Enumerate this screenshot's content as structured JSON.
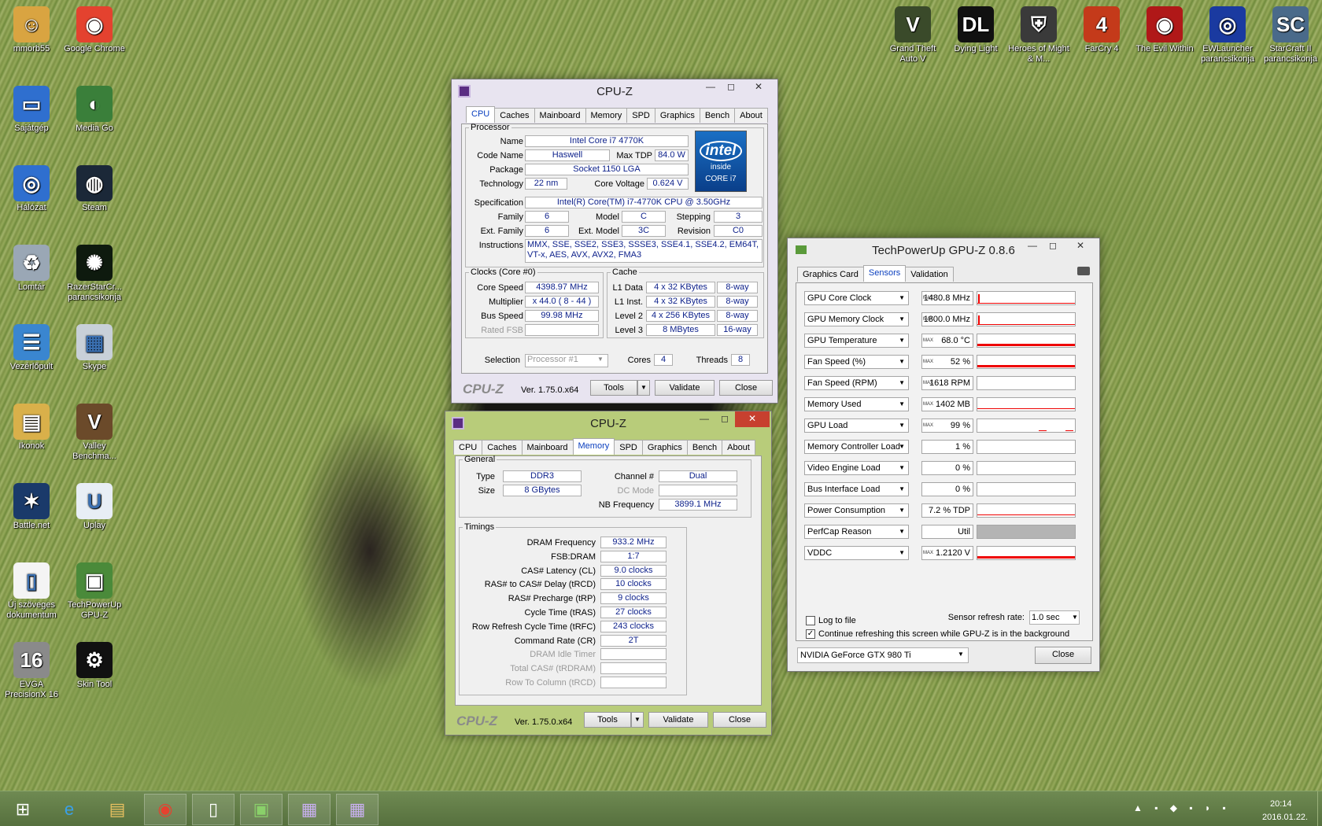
{
  "desktop_icons": [
    {
      "label": "mmorb55",
      "icon": "user-folder-icon",
      "color": "#d9a441"
    },
    {
      "label": "Google Chrome",
      "icon": "chrome-icon",
      "color": "#e4422f"
    },
    {
      "label": "Sajátgép",
      "icon": "computer-icon",
      "color": "#2f6fcf"
    },
    {
      "label": "Media Go",
      "icon": "media-go-icon",
      "color": "#3a7f3a"
    },
    {
      "label": "Hálózat",
      "icon": "network-icon",
      "color": "#2f6fcf"
    },
    {
      "label": "Steam",
      "icon": "steam-icon",
      "color": "#1b2838"
    },
    {
      "label": "Lomtár",
      "icon": "recycle-bin-icon",
      "color": "#9aa7b5"
    },
    {
      "label": "RazerStarCr... parancsikonja",
      "icon": "razer-icon",
      "color": "#0e1a0e"
    },
    {
      "label": "Vezérlőpult",
      "icon": "control-panel-icon",
      "color": "#3a86d0"
    },
    {
      "label": "Skype",
      "icon": "skype-icon",
      "color": "#c8d0d8"
    },
    {
      "label": "Ikonok",
      "icon": "folder-icon",
      "color": "#d9b04a"
    },
    {
      "label": "Valley Benchma...",
      "icon": "valley-icon",
      "color": "#6b4a2a"
    },
    {
      "label": "Battle.net",
      "icon": "battlenet-icon",
      "color": "#1a3a6a"
    },
    {
      "label": "Uplay",
      "icon": "uplay-icon",
      "color": "#e8eef5"
    },
    {
      "label": "Új szöveges dokumentum",
      "icon": "text-document-icon",
      "color": "#f4f4f4"
    },
    {
      "label": "TechPowerUp GPU-Z",
      "icon": "gpuz-icon",
      "color": "#4a8a3a"
    },
    {
      "label": "EVGA PrecisionX 16",
      "icon": "evga-icon",
      "color": "#8a8a8a"
    },
    {
      "label": "Skin Tool",
      "icon": "skin-tool-icon",
      "color": "#111111"
    }
  ],
  "top_icons": [
    {
      "label": "Grand Theft Auto V",
      "icon": "gta-icon"
    },
    {
      "label": "Dying Light",
      "icon": "dying-light-icon"
    },
    {
      "label": "Heroes of Might & M...",
      "icon": "heroes-icon"
    },
    {
      "label": "FarCry 4",
      "icon": "farcry-icon"
    },
    {
      "label": "The Evil Within",
      "icon": "evil-within-icon"
    },
    {
      "label": "EWLauncher parancsikonja",
      "icon": "ewlauncher-icon"
    },
    {
      "label": "StarCraft II parancsikonja",
      "icon": "starcraft-icon"
    }
  ],
  "cpuz1": {
    "title": "CPU-Z",
    "tabs": [
      "CPU",
      "Caches",
      "Mainboard",
      "Memory",
      "SPD",
      "Graphics",
      "Bench",
      "About"
    ],
    "processor_legend": "Processor",
    "name_lbl": "Name",
    "name": "Intel Core i7 4770K",
    "codename_lbl": "Code Name",
    "codename": "Haswell",
    "maxtdp_lbl": "Max TDP",
    "maxtdp": "84.0 W",
    "package_lbl": "Package",
    "package": "Socket 1150 LGA",
    "tech_lbl": "Technology",
    "tech": "22 nm",
    "cv_lbl": "Core Voltage",
    "cv": "0.624 V",
    "spec_lbl": "Specification",
    "spec": "Intel(R) Core(TM) i7-4770K CPU @ 3.50GHz",
    "family_lbl": "Family",
    "family": "6",
    "model_lbl": "Model",
    "model": "C",
    "stepping_lbl": "Stepping",
    "stepping": "3",
    "extfamily_lbl": "Ext. Family",
    "extfamily": "6",
    "extmodel_lbl": "Ext. Model",
    "extmodel": "3C",
    "revision_lbl": "Revision",
    "revision": "C0",
    "instr_lbl": "Instructions",
    "instr": "MMX, SSE, SSE2, SSE3, SSSE3, SSE4.1, SSE4.2, EM64T, VT-x, AES, AVX, AVX2, FMA3",
    "intel_logo": {
      "line1": "intel",
      "line2": "inside",
      "line3": "CORE i7"
    },
    "clocks_legend": "Clocks (Core #0)",
    "corespeed_lbl": "Core Speed",
    "corespeed": "4398.97 MHz",
    "mult_lbl": "Multiplier",
    "mult": "x 44.0 ( 8 - 44 )",
    "bus_lbl": "Bus Speed",
    "bus": "99.98 MHz",
    "fsb_lbl": "Rated FSB",
    "fsb": "",
    "cache_legend": "Cache",
    "l1d_lbl": "L1 Data",
    "l1d": "4 x 32 KBytes",
    "l1d_way": "8-way",
    "l1i_lbl": "L1 Inst.",
    "l1i": "4 x 32 KBytes",
    "l1i_way": "8-way",
    "l2_lbl": "Level 2",
    "l2": "4 x 256 KBytes",
    "l2_way": "8-way",
    "l3_lbl": "Level 3",
    "l3": "8 MBytes",
    "l3_way": "16-way",
    "selection_lbl": "Selection",
    "selection": "Processor #1",
    "cores_lbl": "Cores",
    "cores": "4",
    "threads_lbl": "Threads",
    "threads": "8",
    "brand": "CPU-Z",
    "version": "Ver. 1.75.0.x64",
    "tools": "Tools",
    "validate": "Validate",
    "close": "Close"
  },
  "cpuz2": {
    "title": "CPU-Z",
    "tabs": [
      "CPU",
      "Caches",
      "Mainboard",
      "Memory",
      "SPD",
      "Graphics",
      "Bench",
      "About"
    ],
    "general_legend": "General",
    "type_lbl": "Type",
    "type": "DDR3",
    "size_lbl": "Size",
    "size": "8 GBytes",
    "channel_lbl": "Channel #",
    "channel": "Dual",
    "dcmode_lbl": "DC Mode",
    "dcmode": "",
    "nbfreq_lbl": "NB Frequency",
    "nbfreq": "3899.1 MHz",
    "timings_legend": "Timings",
    "timings": [
      {
        "label": "DRAM Frequency",
        "value": "933.2 MHz",
        "dis": false
      },
      {
        "label": "FSB:DRAM",
        "value": "1:7",
        "dis": false
      },
      {
        "label": "CAS# Latency (CL)",
        "value": "9.0 clocks",
        "dis": false
      },
      {
        "label": "RAS# to CAS# Delay (tRCD)",
        "value": "10 clocks",
        "dis": false
      },
      {
        "label": "RAS# Precharge (tRP)",
        "value": "9 clocks",
        "dis": false
      },
      {
        "label": "Cycle Time (tRAS)",
        "value": "27 clocks",
        "dis": false
      },
      {
        "label": "Row Refresh Cycle Time (tRFC)",
        "value": "243 clocks",
        "dis": false
      },
      {
        "label": "Command Rate (CR)",
        "value": "2T",
        "dis": false
      },
      {
        "label": "DRAM Idle Timer",
        "value": "",
        "dis": true
      },
      {
        "label": "Total CAS# (tRDRAM)",
        "value": "",
        "dis": true
      },
      {
        "label": "Row To Column (tRCD)",
        "value": "",
        "dis": true
      }
    ],
    "brand": "CPU-Z",
    "version": "Ver. 1.75.0.x64",
    "tools": "Tools",
    "validate": "Validate",
    "close": "Close"
  },
  "gpuz": {
    "title": "TechPowerUp GPU-Z 0.8.6",
    "tabs": [
      "Graphics Card",
      "Sensors",
      "Validation"
    ],
    "sensors": [
      {
        "name": "GPU Core Clock",
        "value": "1480.8 MHz",
        "max": true,
        "graph": "spike"
      },
      {
        "name": "GPU Memory Clock",
        "value": "1800.0 MHz",
        "max": true,
        "graph": "spike"
      },
      {
        "name": "GPU Temperature",
        "value": "68.0 °C",
        "max": true,
        "graph": "full"
      },
      {
        "name": "Fan Speed (%)",
        "value": "52 %",
        "max": true,
        "graph": "full"
      },
      {
        "name": "Fan Speed (RPM)",
        "value": "1618 RPM",
        "max": true,
        "graph": "none"
      },
      {
        "name": "Memory Used",
        "value": "1402 MB",
        "max": true,
        "graph": "thin"
      },
      {
        "name": "GPU Load",
        "value": "99 %",
        "max": true,
        "graph": "dots"
      },
      {
        "name": "Memory Controller Load",
        "value": "1 %",
        "max": false,
        "graph": "none"
      },
      {
        "name": "Video Engine Load",
        "value": "0 %",
        "max": false,
        "graph": "none"
      },
      {
        "name": "Bus Interface Load",
        "value": "0 %",
        "max": false,
        "graph": "none"
      },
      {
        "name": "Power Consumption",
        "value": "7.2 % TDP",
        "max": false,
        "graph": "thin"
      },
      {
        "name": "PerfCap Reason",
        "value": "Util",
        "max": false,
        "graph": "gray"
      },
      {
        "name": "VDDC",
        "value": "1.2120 V",
        "max": true,
        "graph": "full"
      }
    ],
    "max_tag": "MAX",
    "log_lbl": "Log to file",
    "refresh_lbl": "Sensor refresh rate:",
    "refresh": "1.0 sec",
    "continue_lbl": "Continue refreshing this screen while GPU-Z is in the background",
    "card": "NVIDIA GeForce GTX 980 Ti",
    "close": "Close"
  },
  "taskbar": {
    "items": [
      {
        "name": "start-button",
        "icon": "windows-logo-icon"
      },
      {
        "name": "taskbar-ie",
        "icon": "internet-explorer-icon"
      },
      {
        "name": "taskbar-explorer",
        "icon": "file-explorer-icon"
      },
      {
        "name": "taskbar-chrome",
        "icon": "chrome-icon"
      },
      {
        "name": "taskbar-notepad",
        "icon": "notepad-icon"
      },
      {
        "name": "taskbar-gpuz",
        "icon": "gpuz-icon"
      },
      {
        "name": "taskbar-cpuz-1",
        "icon": "cpuz-icon"
      },
      {
        "name": "taskbar-cpuz-2",
        "icon": "cpuz-icon"
      }
    ],
    "time": "20:14",
    "date": "2016.01.22."
  }
}
